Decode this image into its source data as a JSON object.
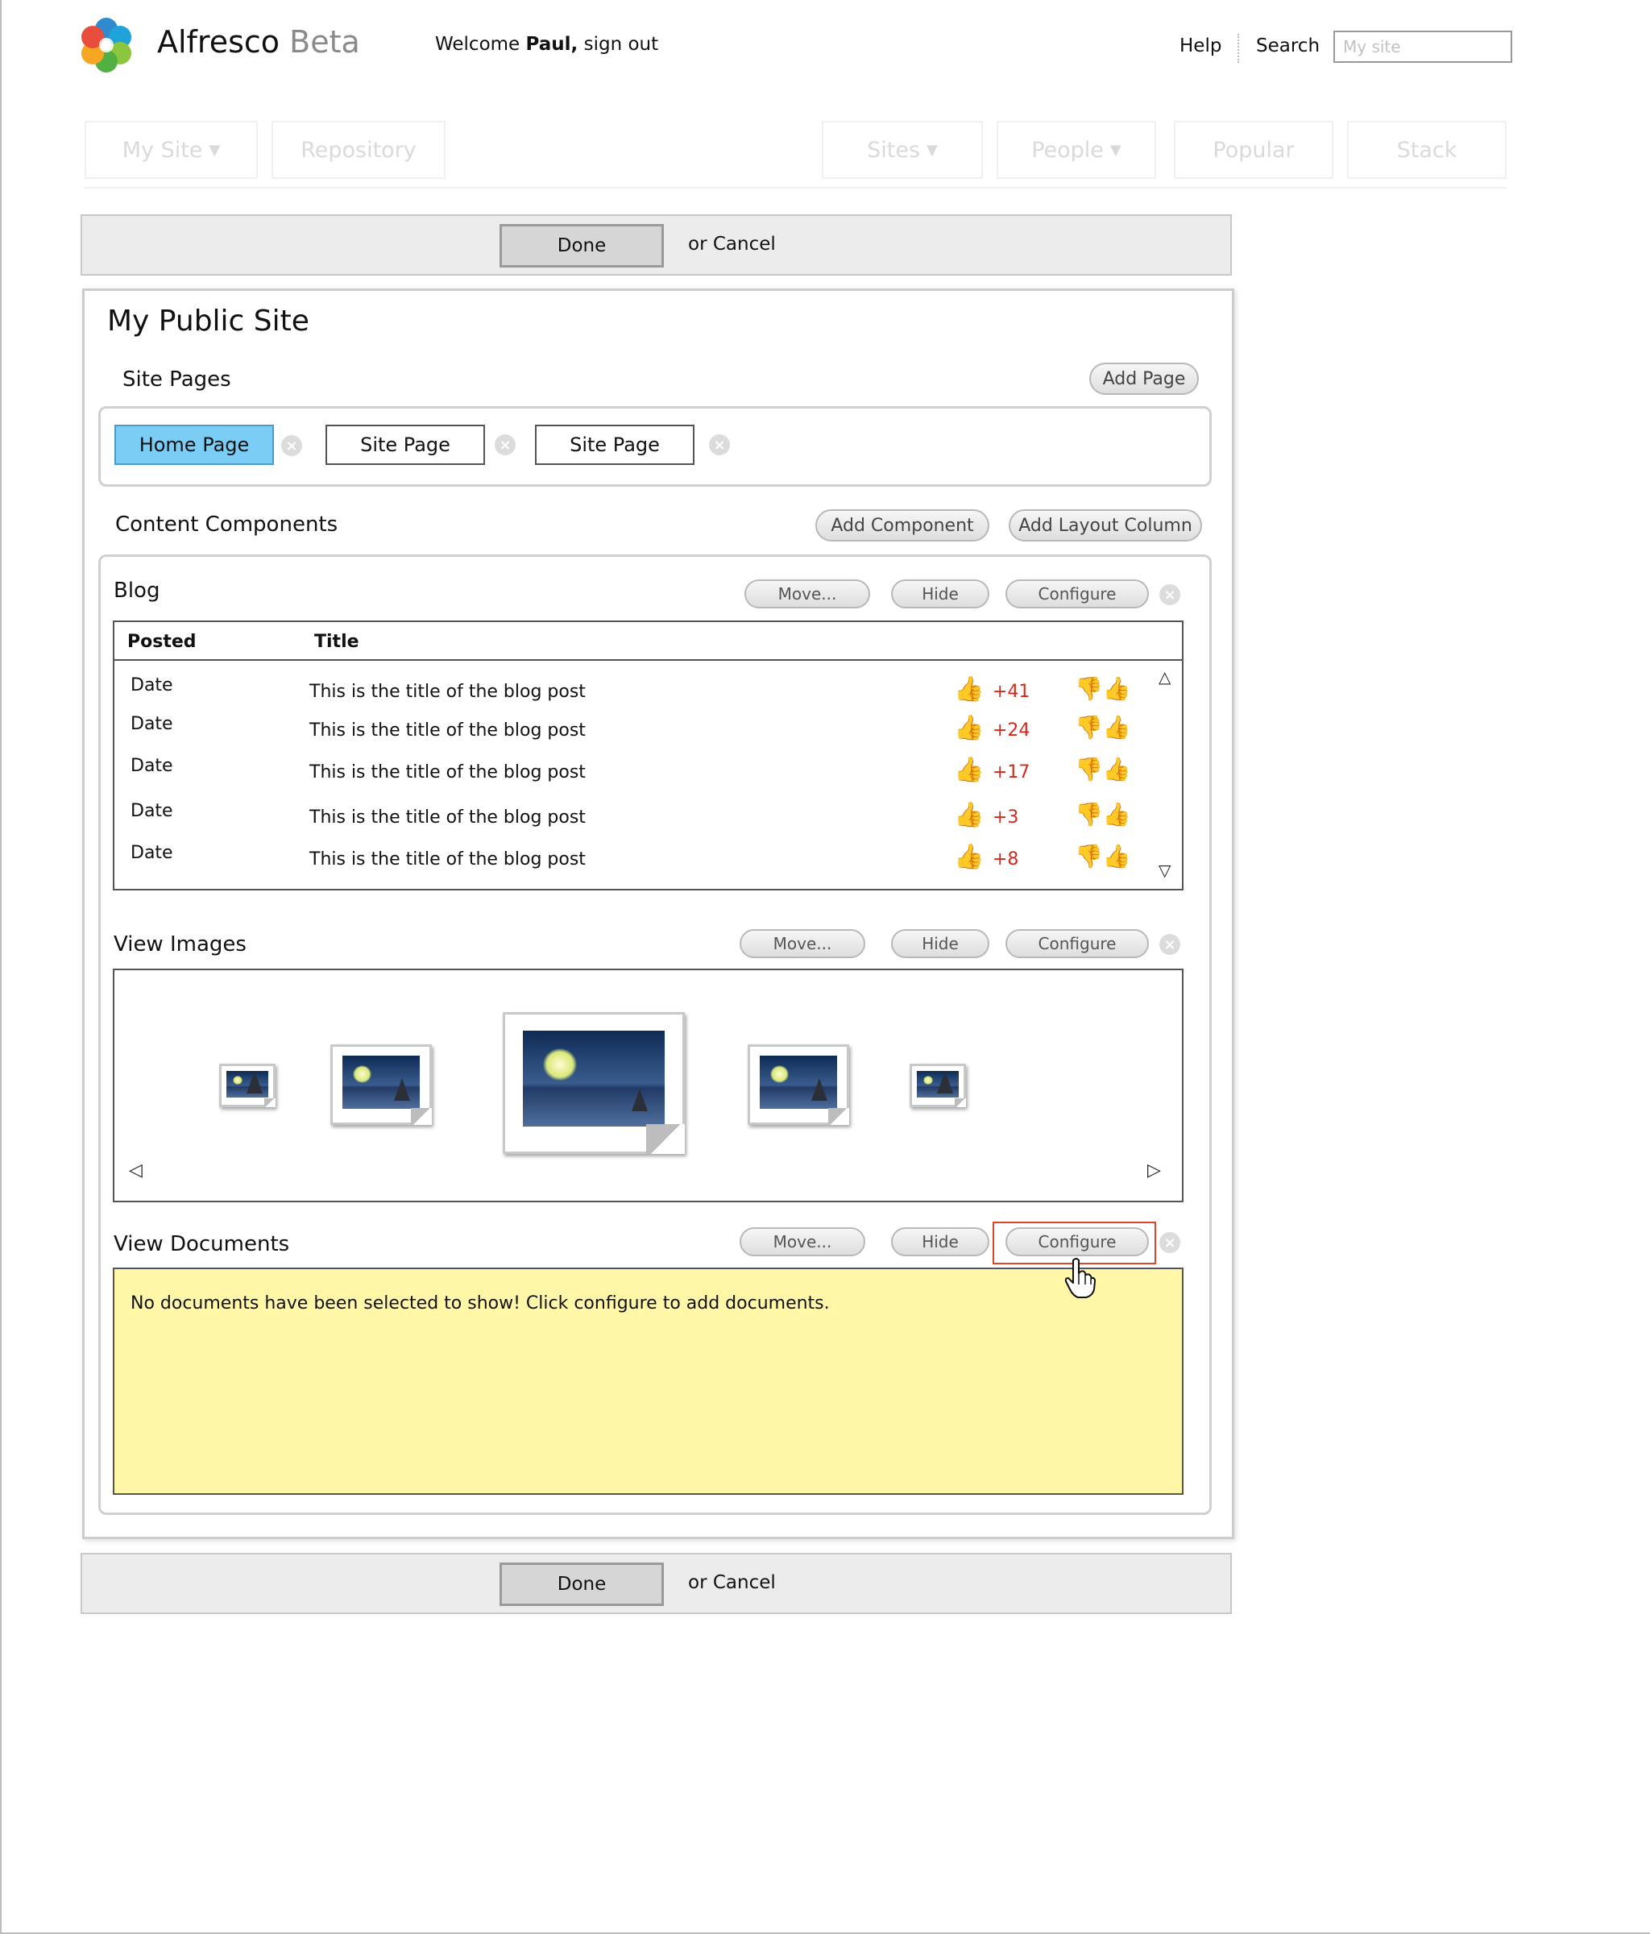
{
  "header": {
    "brand_name": "Alfresco",
    "brand_tag": "Beta",
    "welcome_prefix": "Welcome",
    "user_name": "Paul,",
    "sign_out": "sign out",
    "help": "Help",
    "search": "Search",
    "search_placeholder": "My site"
  },
  "nav": {
    "my_site": "My Site",
    "repository": "Repository",
    "sites": "Sites",
    "people": "People",
    "popular": "Popular",
    "stack": "Stack",
    "caret": "▼"
  },
  "actions": {
    "done": "Done",
    "cancel": "or Cancel"
  },
  "site": {
    "title": "My Public Site",
    "site_pages_label": "Site Pages",
    "add_page": "Add Page",
    "pages": [
      "Home Page",
      "Site Page",
      "Site Page"
    ],
    "content_components_label": "Content Components",
    "add_component": "Add Component",
    "add_layout_column": "Add Layout Column"
  },
  "component_buttons": {
    "move": "Move...",
    "hide": "Hide",
    "configure": "Configure"
  },
  "blog": {
    "title": "Blog",
    "col_posted": "Posted",
    "col_title": "Title",
    "rows": [
      {
        "date": "Date",
        "title": "This is the title of the blog post",
        "votes": "+41"
      },
      {
        "date": "Date",
        "title": "This is the title of the blog post",
        "votes": "+24"
      },
      {
        "date": "Date",
        "title": "This is the title of the blog post",
        "votes": "+17"
      },
      {
        "date": "Date",
        "title": "This is the title of the blog post",
        "votes": "+3"
      },
      {
        "date": "Date",
        "title": "This is the title of the blog post",
        "votes": "+8"
      }
    ]
  },
  "images": {
    "title": "View Images"
  },
  "documents": {
    "title": "View Documents",
    "empty_message": "No documents have been selected to show! Click configure to add documents."
  },
  "colors": {
    "active_page_tab": "#7bcdf5",
    "documents_background": "#fff6a8",
    "vote_count": "#d02a1a",
    "highlight_border": "#d9472c"
  },
  "icons": {
    "logo": "alfresco-flower-logo",
    "remove": "close-circle-icon",
    "vote": "thumbs-up-icon",
    "cursor": "hand-pointer-icon"
  }
}
